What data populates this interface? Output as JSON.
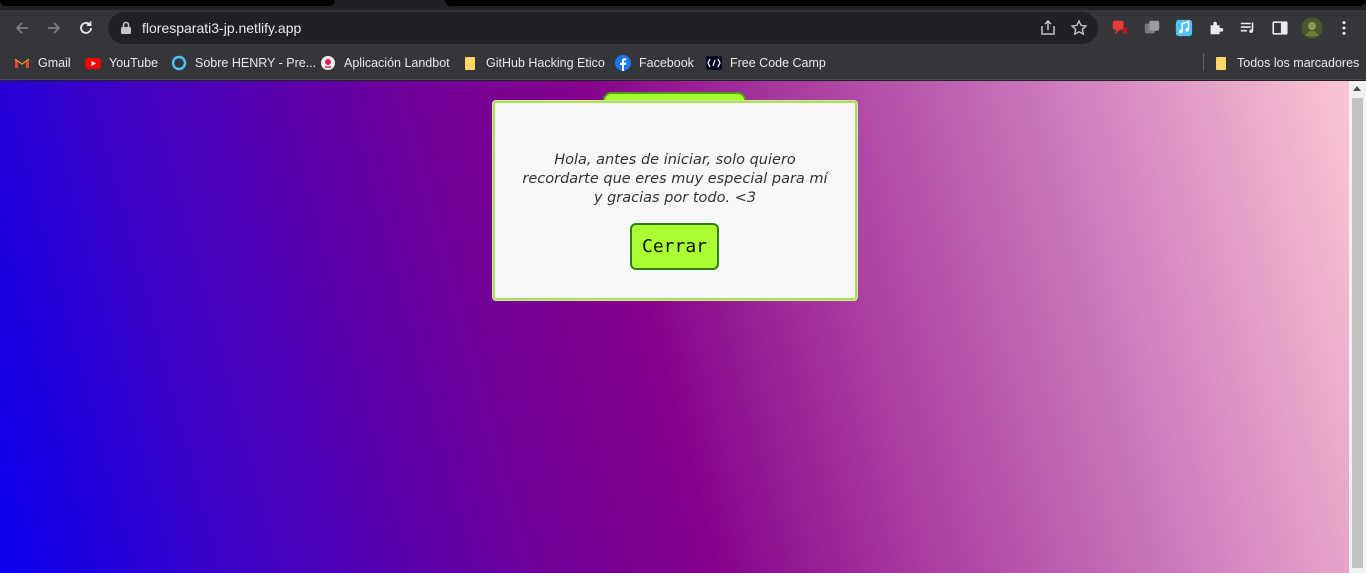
{
  "browser": {
    "url": "floresparati3-jp.netlify.app",
    "bookmarks": [
      {
        "label": "Gmail",
        "icon": "gmail-icon"
      },
      {
        "label": "YouTube",
        "icon": "youtube-icon"
      },
      {
        "label": "Sobre HENRY - Pre...",
        "icon": "henry-icon"
      },
      {
        "label": "Aplicación Landbot",
        "icon": "landbot-icon"
      },
      {
        "label": "GitHub Hacking Etico",
        "icon": "folder-icon"
      },
      {
        "label": "Facebook",
        "icon": "facebook-icon"
      },
      {
        "label": "Free Code Camp",
        "icon": "freecodecamp-icon"
      }
    ],
    "other_bookmarks": "Todos los marcadores"
  },
  "modal": {
    "message": "Hola, antes de iniciar, solo quiero recordarte que eres muy especial para mí y gracias por todo. <3",
    "close_label": "Cerrar"
  },
  "colors": {
    "accent_green": "#aaff33",
    "gradient_start": "#0a00ef",
    "gradient_mid": "#85008b",
    "gradient_end": "#fbc6d3"
  }
}
